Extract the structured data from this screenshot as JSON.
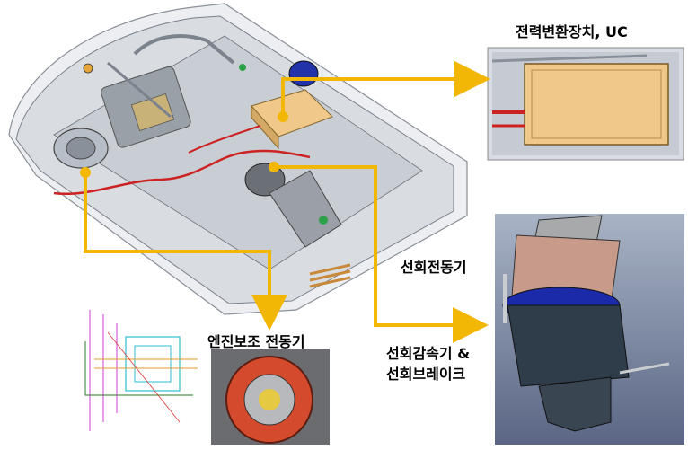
{
  "labels": {
    "uc": "전력변환장치, UC",
    "swing_motor": "선회전동기",
    "engine_assist_motor": "엔진보조 전동기",
    "reducer_line1": "선회감속기 &",
    "reducer_line2": "선회브레이크"
  },
  "colors": {
    "arrow": "#f2b705",
    "uc_box": "#f0c98a",
    "frame": "#d7d9dd",
    "motor_blue": "#1a2aa8",
    "motor_copper": "#c89a8a",
    "motor_body": "#2f3c4a"
  }
}
